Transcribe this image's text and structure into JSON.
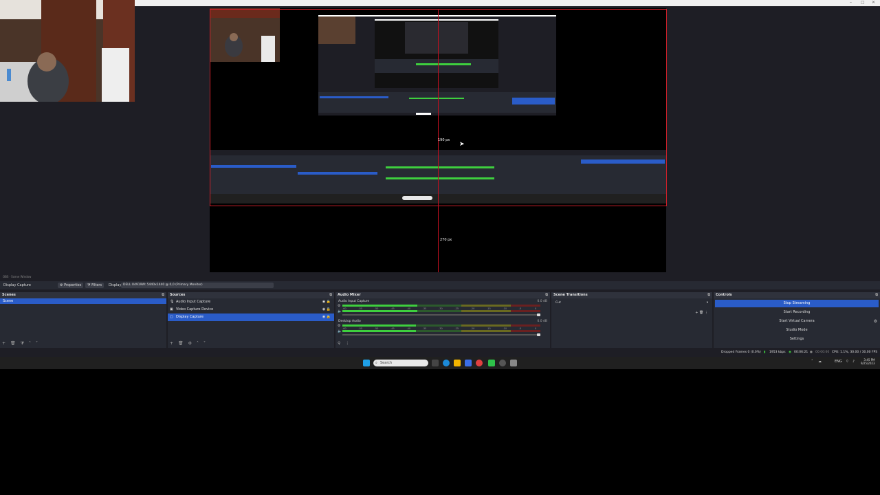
{
  "window": {
    "min_glyph": "–",
    "max_glyph": "□",
    "close_glyph": "✕"
  },
  "toolbar_strip": {
    "text": "OBS · Scene Window"
  },
  "context_bar": {
    "source_name": "Display Capture",
    "properties_label": "Properties",
    "filters_label": "Filters",
    "display_label": "Display",
    "display_value": "DELL U4919W: 5440x1440 @ 0,0 (Primary Monitor)"
  },
  "preview": {
    "top_measure": "190 px",
    "bottom_measure": "270 px"
  },
  "docks": {
    "scenes": {
      "title": "Scenes",
      "items": [
        {
          "label": "Scene",
          "selected": true
        }
      ]
    },
    "sources": {
      "title": "Sources",
      "items": [
        {
          "label": "Audio Input Capture",
          "icon": "microphone-icon",
          "glyph": "🎙",
          "selected": false
        },
        {
          "label": "Video Capture Device",
          "icon": "camera-icon",
          "glyph": "▣",
          "selected": false
        },
        {
          "label": "Display Capture",
          "icon": "monitor-icon",
          "glyph": "▢",
          "selected": true
        }
      ]
    },
    "mixer": {
      "title": "Audio Mixer",
      "channels": [
        {
          "name": "Audio Input Capture",
          "db": "0.0 dB",
          "level": 0.38
        },
        {
          "name": "Desktop Audio",
          "db": "0.0 dB",
          "level": 0.37
        }
      ],
      "ticks": [
        "-60",
        "-55",
        "-50",
        "-45",
        "-40",
        "-35",
        "-30",
        "-25",
        "-20",
        "-15",
        "-10",
        "-5",
        "0"
      ]
    },
    "transitions": {
      "title": "Scene Transitions",
      "selected": "Cut"
    },
    "controls": {
      "title": "Controls",
      "buttons": [
        {
          "label": "Stop Streaming",
          "primary": true
        },
        {
          "label": "Start Recording",
          "primary": false
        },
        {
          "label": "Start Virtual Camera",
          "primary": false
        },
        {
          "label": "Studio Mode",
          "primary": false
        },
        {
          "label": "Settings",
          "primary": false
        }
      ]
    }
  },
  "status": {
    "dropped_frames": "Dropped Frames 0 (0.0%)",
    "bitrate": "1953 kbps",
    "stream_time": "00:06:21",
    "rec_time": "00:00:00",
    "cpu_fps": "CPU: 1.1%, 30.00 / 30.00 FPS"
  },
  "taskbar": {
    "search_placeholder": "Search",
    "time": "3:45 PM",
    "date": "9/25/2023",
    "lang": "ENG"
  },
  "colors": {
    "accent": "#2a5cc8",
    "guide_red": "#d0202a",
    "panel": "#272a33",
    "background": "#1e1e25"
  }
}
